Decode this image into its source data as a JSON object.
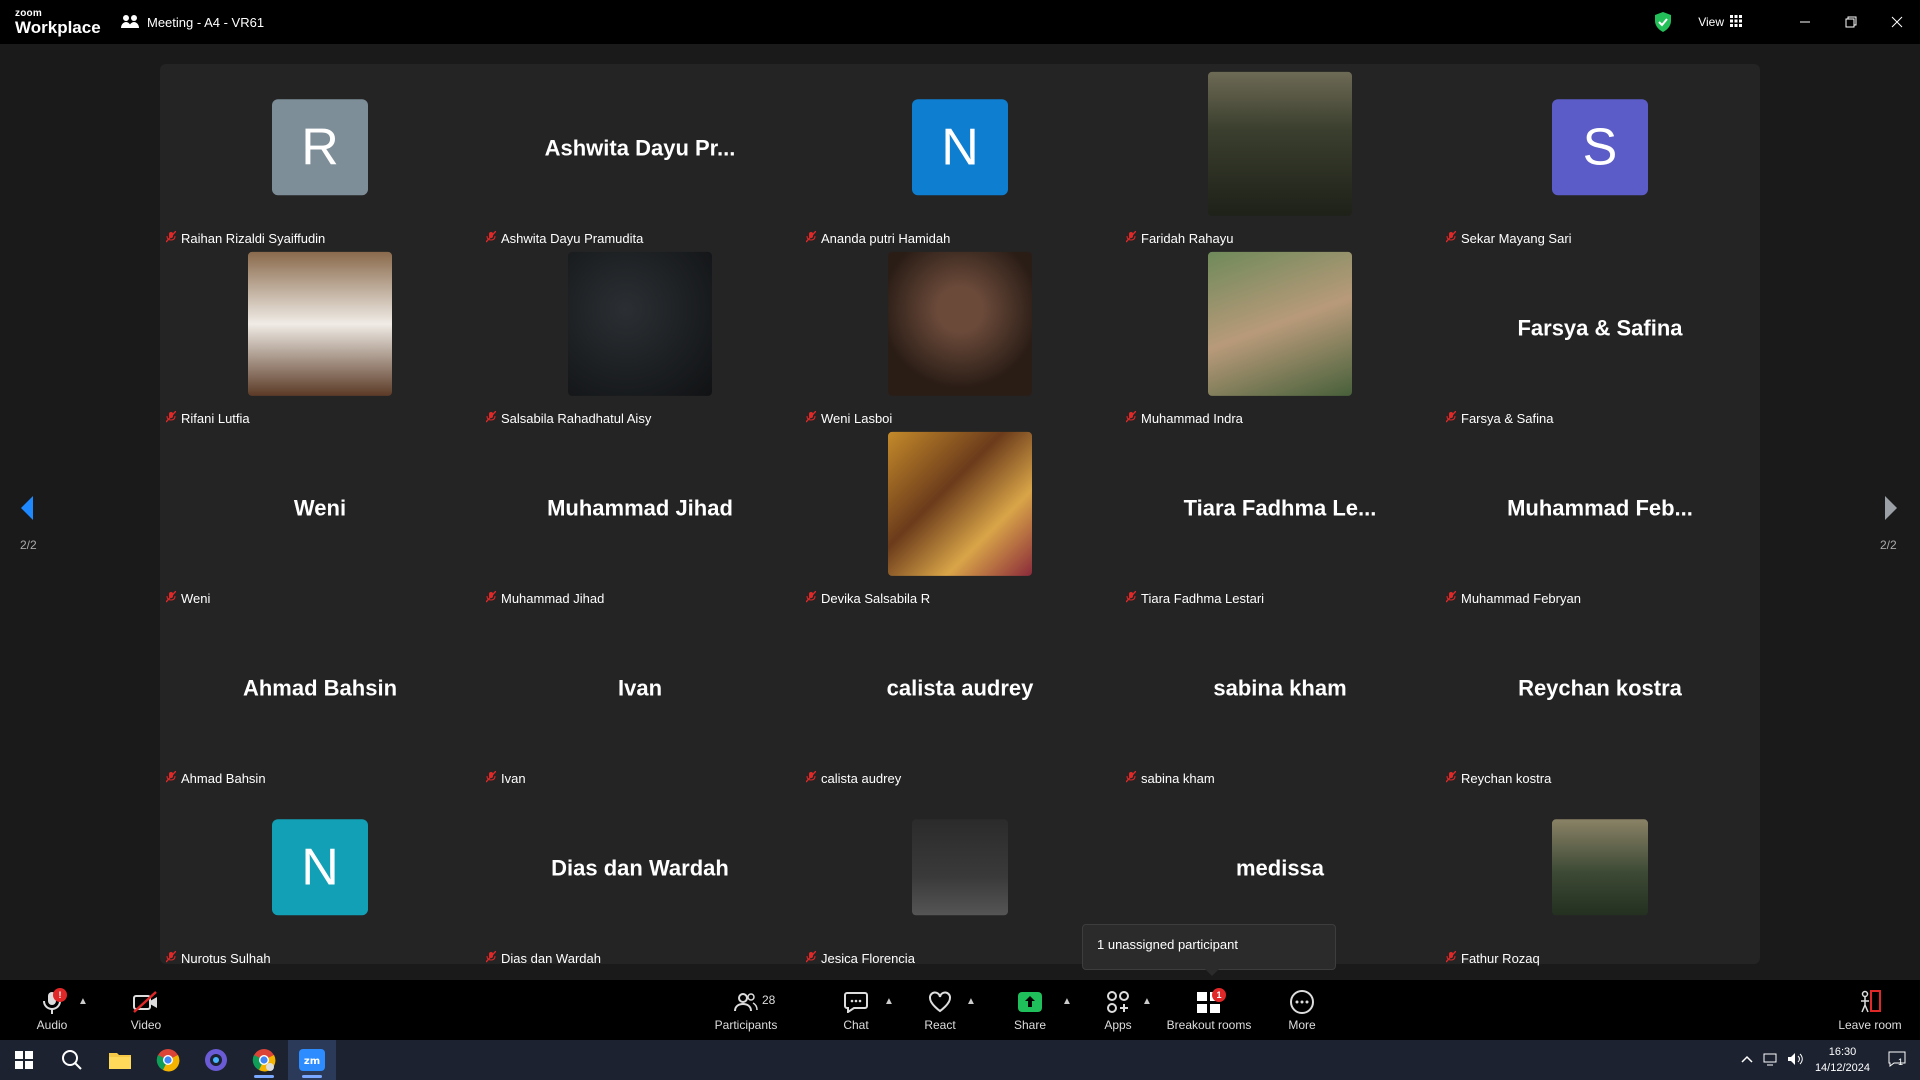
{
  "titlebar": {
    "logo_top": "zoom",
    "logo_bottom": "Workplace",
    "meeting_title": "Meeting - A4 - VR61",
    "view_label": "View"
  },
  "gallery": {
    "page_label_left": "2/2",
    "page_label_right": "2/2",
    "tiles": [
      {
        "name": "Raihan Rizaldi Syaiffudin",
        "display": "R",
        "kind": "initial",
        "color": "#7d8e98"
      },
      {
        "name": "Ashwita Dayu Pramudita",
        "display": "Ashwita Dayu Pr...",
        "kind": "text"
      },
      {
        "name": "Ananda putri Hamidah",
        "display": "N",
        "kind": "initial",
        "color": "#0e7ed0"
      },
      {
        "name": "Faridah Rahayu",
        "display": "",
        "kind": "photo"
      },
      {
        "name": "Sekar Mayang Sari",
        "display": "S",
        "kind": "initial",
        "color": "#5b5cc7"
      },
      {
        "name": "Rifani Lutfia",
        "display": "",
        "kind": "photo"
      },
      {
        "name": "Salsabila Rahadhatul Aisy",
        "display": "",
        "kind": "photo"
      },
      {
        "name": "Weni Lasboi",
        "display": "",
        "kind": "photo"
      },
      {
        "name": "Muhammad Indra",
        "display": "",
        "kind": "photo"
      },
      {
        "name": "Farsya & Safina",
        "display": "Farsya & Safina",
        "kind": "text"
      },
      {
        "name": "Weni",
        "display": "Weni",
        "kind": "text"
      },
      {
        "name": "Muhammad Jihad",
        "display": "Muhammad Jihad",
        "kind": "text"
      },
      {
        "name": "Devika Salsabila R",
        "display": "",
        "kind": "photo"
      },
      {
        "name": "Tiara Fadhma Lestari",
        "display": "Tiara Fadhma Le...",
        "kind": "text"
      },
      {
        "name": "Muhammad Febryan",
        "display": "Muhammad Feb...",
        "kind": "text"
      },
      {
        "name": "Ahmad Bahsin",
        "display": "Ahmad Bahsin",
        "kind": "text"
      },
      {
        "name": "Ivan",
        "display": "Ivan",
        "kind": "text"
      },
      {
        "name": "calista audrey",
        "display": "calista audrey",
        "kind": "text"
      },
      {
        "name": "sabina kham",
        "display": "sabina kham",
        "kind": "text"
      },
      {
        "name": "Reychan kostra",
        "display": "Reychan kostra",
        "kind": "text"
      },
      {
        "name": "Nurotus Sulhah",
        "display": "N",
        "kind": "initial",
        "color": "#11a0b5"
      },
      {
        "name": "Dias dan Wardah",
        "display": "Dias dan Wardah",
        "kind": "text"
      },
      {
        "name": "Jesica Florencia",
        "display": "",
        "kind": "photo-small"
      },
      {
        "name": "",
        "display": "medissa",
        "kind": "text"
      },
      {
        "name": "Fathur Rozaq",
        "display": "",
        "kind": "photo-small"
      }
    ]
  },
  "tooltip": {
    "text": "1 unassigned participant"
  },
  "toolbar": {
    "audio": "Audio",
    "video": "Video",
    "participants": "Participants",
    "participants_count": "28",
    "chat": "Chat",
    "react": "React",
    "share": "Share",
    "apps": "Apps",
    "breakout": "Breakout rooms",
    "breakout_badge": "1",
    "more": "More",
    "leave": "Leave room"
  },
  "taskbar": {
    "time": "16:30",
    "date": "14/12/2024",
    "notif_count": "1"
  },
  "colors": {
    "accent": "#0b5cff",
    "share_green": "#1fbf5b",
    "mute_red": "#e02828",
    "shield_green": "#23c05a"
  }
}
